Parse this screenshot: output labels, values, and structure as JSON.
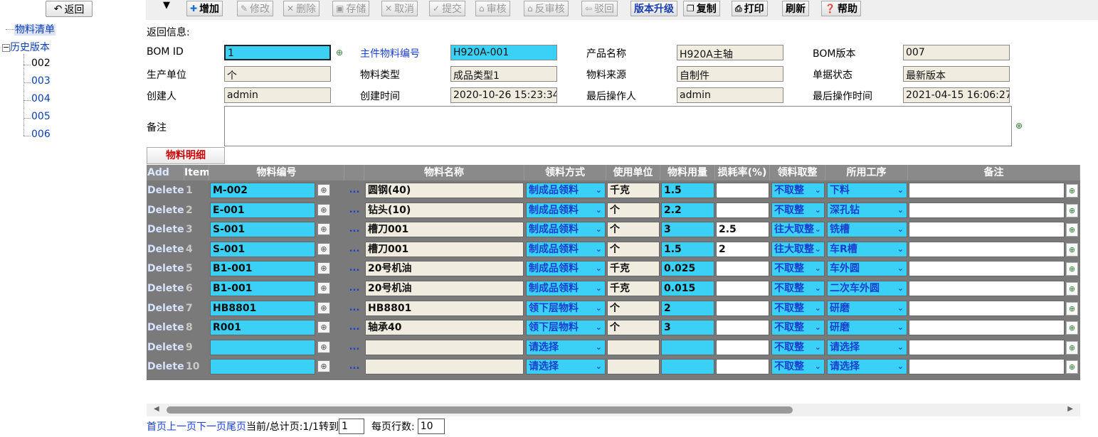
{
  "back_label": "返回",
  "tree": {
    "root_label": "物料清单",
    "history_label": "历史版本",
    "versions": [
      "002",
      "003",
      "004",
      "005",
      "006"
    ]
  },
  "toolbar": {
    "add": "增加",
    "edit": "修改",
    "delete": "删除",
    "save": "存储",
    "cancel": "取消",
    "submit": "提交",
    "audit": "审核",
    "unaudit": "反审核",
    "reject": "驳回",
    "upgrade": "版本升级",
    "copy": "复制",
    "print": "打印",
    "refresh": "刷新",
    "help": "帮助"
  },
  "form": {
    "return_info_label": "返回信息:",
    "bom_id_label": "BOM ID",
    "bom_id": "1",
    "main_code_label": "主件物料编号",
    "main_code": "H920A-001",
    "product_name_label": "产品名称",
    "product_name": "H920A主轴",
    "bom_version_label": "BOM版本",
    "bom_version": "007",
    "unit_label": "生产单位",
    "unit": "个",
    "material_type_label": "物料类型",
    "material_type": "成品类型1",
    "material_source_label": "物料来源",
    "material_source": "自制件",
    "doc_status_label": "单据状态",
    "doc_status": "最新版本",
    "creator_label": "创建人",
    "creator": "admin",
    "create_time_label": "创建时间",
    "create_time": "2020-10-26 15:23:34",
    "last_operator_label": "最后操作人",
    "last_operator": "admin",
    "last_op_time_label": "最后操作时间",
    "last_op_time": "2021-04-15 16:06:27",
    "memo_label": "备注",
    "memo": ""
  },
  "detail_tab": "物料明细",
  "grid": {
    "headers": {
      "add": "Add",
      "item": "Item",
      "code": "物料编号",
      "name": "物料名称",
      "method": "领料方式",
      "unit": "使用单位",
      "qty": "物料用量",
      "loss": "损耗率(%)",
      "round": "领料取整",
      "process": "所用工序",
      "remark": "备注"
    },
    "delete_label": "Delete",
    "dots_label": "...",
    "rows": [
      {
        "item": "1",
        "code": "M-002",
        "name": "圆钢(40)",
        "method": "制成品领料",
        "unit": "千克",
        "qty": "1.5",
        "loss": "",
        "round": "不取整",
        "process": "下料",
        "remark": ""
      },
      {
        "item": "2",
        "code": "E-001",
        "name": "钻头(10)",
        "method": "制成品领料",
        "unit": "个",
        "qty": "2.2",
        "loss": "",
        "round": "不取整",
        "process": "深孔钻",
        "remark": ""
      },
      {
        "item": "3",
        "code": "S-001",
        "name": "槽刀001",
        "method": "制成品领料",
        "unit": "个",
        "qty": "3",
        "loss": "2.5",
        "round": "往大取整",
        "process": "铣槽",
        "remark": ""
      },
      {
        "item": "4",
        "code": "S-001",
        "name": "槽刀001",
        "method": "制成品领料",
        "unit": "个",
        "qty": "1.5",
        "loss": "2",
        "round": "往大取整",
        "process": "车R槽",
        "remark": ""
      },
      {
        "item": "5",
        "code": "B1-001",
        "name": "20号机油",
        "method": "制成品领料",
        "unit": "千克",
        "qty": "0.025",
        "loss": "",
        "round": "不取整",
        "process": "车外圆",
        "remark": ""
      },
      {
        "item": "6",
        "code": "B1-001",
        "name": "20号机油",
        "method": "制成品领料",
        "unit": "千克",
        "qty": "0.015",
        "loss": "",
        "round": "不取整",
        "process": "二次车外圆",
        "remark": ""
      },
      {
        "item": "7",
        "code": "HB8801",
        "name": "HB8801",
        "method": "领下层物料",
        "unit": "个",
        "qty": "2",
        "loss": "",
        "round": "不取整",
        "process": "研磨",
        "remark": ""
      },
      {
        "item": "8",
        "code": "R001",
        "name": "轴承40",
        "method": "领下层物料",
        "unit": "个",
        "qty": "3",
        "loss": "",
        "round": "不取整",
        "process": "研磨",
        "remark": ""
      },
      {
        "item": "9",
        "code": "",
        "name": "",
        "method": "请选择",
        "unit": "",
        "qty": "",
        "loss": "",
        "round": "不取整",
        "process": "请选择",
        "remark": ""
      },
      {
        "item": "10",
        "code": "",
        "name": "",
        "method": "请选择",
        "unit": "",
        "qty": "",
        "loss": "",
        "round": "不取整",
        "process": "请选择",
        "remark": ""
      }
    ]
  },
  "pager": {
    "first": "首页",
    "prev": "上一页",
    "next": "下一页",
    "last": "尾页",
    "status": "当前/总计页:1/1转到",
    "goto_page": "1",
    "rows_label": "每页行数:",
    "rows_per_page": "10"
  }
}
